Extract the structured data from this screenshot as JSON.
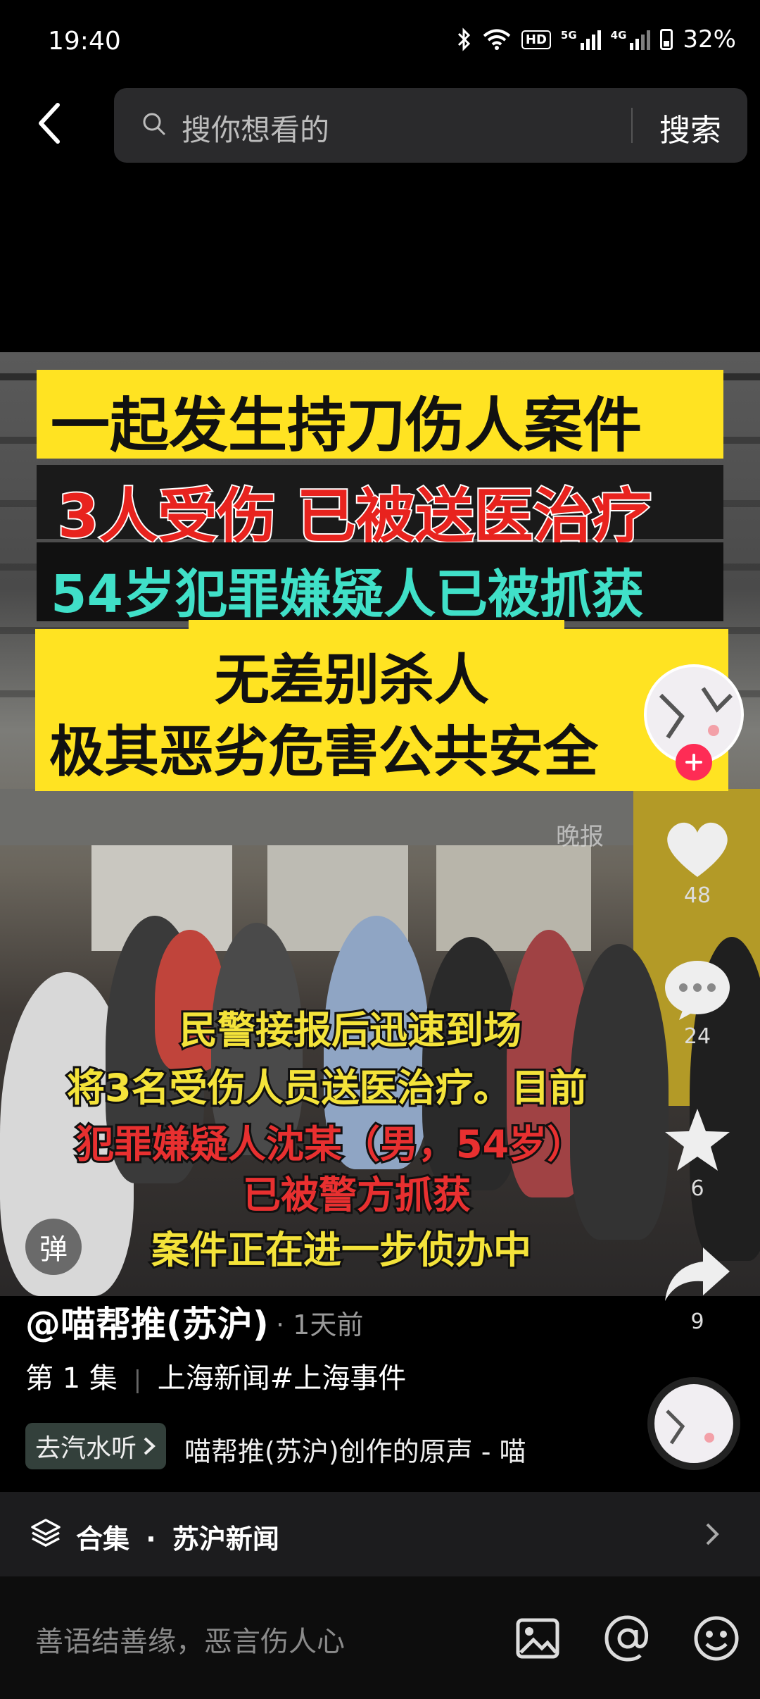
{
  "status_bar": {
    "time": "19:40",
    "hd_label": "HD",
    "signal1_label": "5G",
    "signal2_label": "4G",
    "battery": "32%"
  },
  "search": {
    "placeholder": "搜你想看的",
    "button": "搜索"
  },
  "video": {
    "captions": {
      "line1": "一起发生持刀伤人案件",
      "line2": "3人受伤 已被送医治疗",
      "line3": "54岁犯罪嫌疑人已被抓获",
      "line4a": "无差别杀人",
      "line4b": "极其恶劣危害公共安全"
    },
    "subtitles": {
      "s1": "民警接报后迅速到场",
      "s2": "将3名受伤人员送医治疗。目前",
      "s3": "犯罪嫌疑人沈某（男，54岁）",
      "s4": "已被警方抓获",
      "s5": "案件正在进一步侦办中"
    },
    "watermark": "晚报",
    "danmaku_label": "弹"
  },
  "rail": {
    "like_count": "48",
    "comment_count": "24",
    "favorite_count": "6",
    "share_count": "9"
  },
  "post": {
    "author": "@喵帮推(苏沪)",
    "time_ago": "· 1天前",
    "episode": "第 1 集",
    "episode_sep": "|",
    "description": "上海新闻#上海事件",
    "music_button": "去汽水听",
    "music_text": "喵帮推(苏沪)创作的原声 - 喵"
  },
  "collection": {
    "label": "合集",
    "dot": "·",
    "name": "苏沪新闻"
  },
  "comment": {
    "placeholder": "善语结善缘，恶言伤人心"
  },
  "colors": {
    "caption_yellow": "#ffe322",
    "caption_red": "#e8231e",
    "caption_teal": "#40e0c8",
    "like_pink": "#fe2c55"
  }
}
